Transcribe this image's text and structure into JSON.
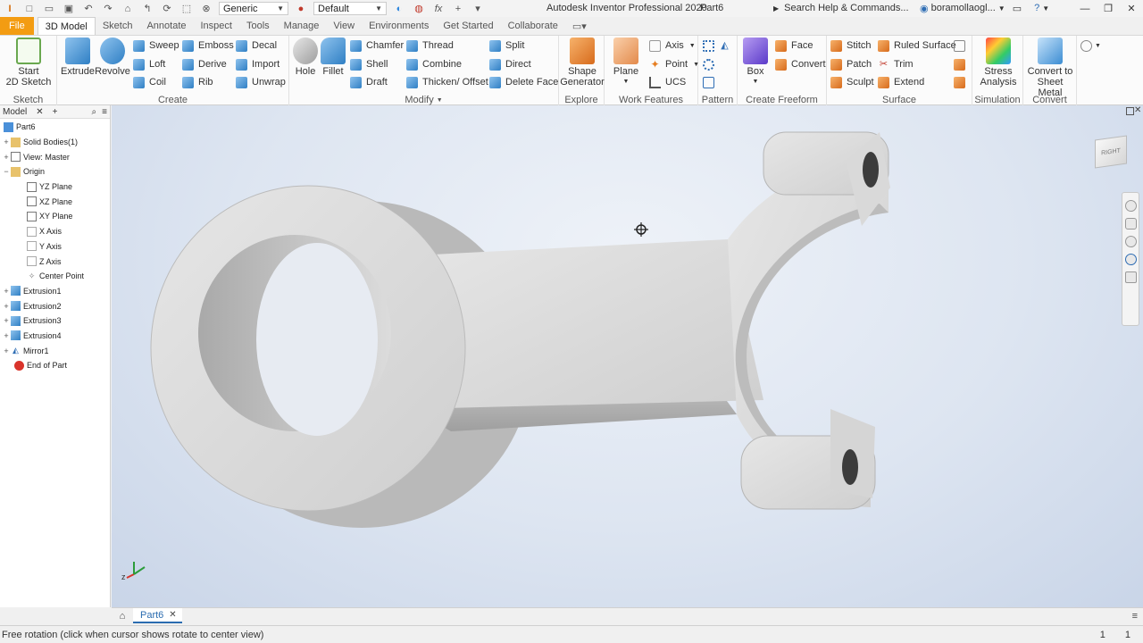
{
  "titlebar": {
    "material": "Generic",
    "appearance": "Default",
    "app_title": "Autodesk Inventor Professional 2020",
    "doc_title": "Part6",
    "search_placeholder": "Search Help & Commands...",
    "user": "boramollaogl..."
  },
  "tabs": [
    {
      "label": "File"
    },
    {
      "label": "3D Model"
    },
    {
      "label": "Sketch"
    },
    {
      "label": "Annotate"
    },
    {
      "label": "Inspect"
    },
    {
      "label": "Tools"
    },
    {
      "label": "Manage"
    },
    {
      "label": "View"
    },
    {
      "label": "Environments"
    },
    {
      "label": "Get Started"
    },
    {
      "label": "Collaborate"
    }
  ],
  "ribbon": {
    "sketch": {
      "start_2d_sketch_line1": "Start",
      "start_2d_sketch_line2": "2D Sketch",
      "label": "Sketch"
    },
    "create": {
      "extrude": "Extrude",
      "revolve": "Revolve",
      "sweep": "Sweep",
      "loft": "Loft",
      "coil": "Coil",
      "emboss": "Emboss",
      "derive": "Derive",
      "rib": "Rib",
      "decal": "Decal",
      "import": "Import",
      "unwrap": "Unwrap",
      "label": "Create"
    },
    "modify": {
      "hole": "Hole",
      "fillet": "Fillet",
      "chamfer": "Chamfer",
      "shell": "Shell",
      "draft": "Draft",
      "thread": "Thread",
      "combine": "Combine",
      "thicken": "Thicken/ Offset",
      "split": "Split",
      "direct": "Direct",
      "delete_face": "Delete Face",
      "label": "Modify"
    },
    "explore": {
      "shape_line1": "Shape",
      "shape_line2": "Generator",
      "label": "Explore"
    },
    "work": {
      "plane": "Plane",
      "axis": "Axis",
      "point": "Point",
      "ucs": "UCS",
      "label": "Work Features"
    },
    "pattern": {
      "label": "Pattern"
    },
    "freeform": {
      "box": "Box",
      "face": "Face",
      "convert": "Convert",
      "label": "Create Freeform"
    },
    "surface": {
      "stitch": "Stitch",
      "patch": "Patch",
      "sculpt": "Sculpt",
      "ruled": "Ruled Surface",
      "trim": "Trim",
      "extend": "Extend",
      "label": "Surface"
    },
    "simulation": {
      "stress_line1": "Stress",
      "stress_line2": "Analysis",
      "label": "Simulation"
    },
    "convert": {
      "sheet_line1": "Convert to",
      "sheet_line2": "Sheet Metal",
      "label": "Convert"
    }
  },
  "browser": {
    "tab": "Model",
    "items": [
      {
        "label": "Part6",
        "expander": ""
      },
      {
        "label": "Solid Bodies(1)",
        "expander": "+"
      },
      {
        "label": "View: Master",
        "expander": "+"
      },
      {
        "label": "Origin",
        "expander": "−"
      },
      {
        "label": "YZ Plane",
        "expander": ""
      },
      {
        "label": "XZ Plane",
        "expander": ""
      },
      {
        "label": "XY Plane",
        "expander": ""
      },
      {
        "label": "X Axis",
        "expander": ""
      },
      {
        "label": "Y Axis",
        "expander": ""
      },
      {
        "label": "Z Axis",
        "expander": ""
      },
      {
        "label": "Center Point",
        "expander": ""
      },
      {
        "label": "Extrusion1",
        "expander": "+"
      },
      {
        "label": "Extrusion2",
        "expander": "+"
      },
      {
        "label": "Extrusion3",
        "expander": "+"
      },
      {
        "label": "Extrusion4",
        "expander": "+"
      },
      {
        "label": "Mirror1",
        "expander": "+"
      },
      {
        "label": "End of Part",
        "expander": ""
      }
    ]
  },
  "viewcube": {
    "face": "RIGHT"
  },
  "doc_tab": {
    "label": "Part6"
  },
  "status": {
    "text": "Free rotation (click when cursor shows rotate to center view)",
    "count1": "1",
    "count2": "1"
  }
}
